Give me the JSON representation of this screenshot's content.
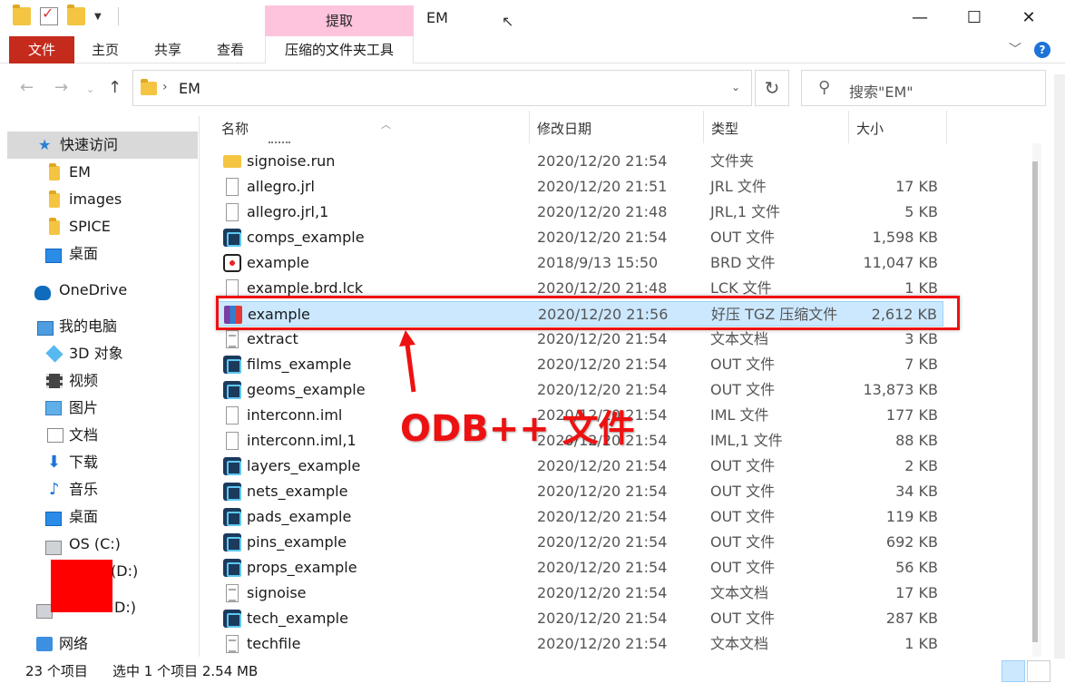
{
  "window": {
    "title": "EM",
    "context_tab_header": "提取",
    "minimize": "—",
    "maximize": "☐",
    "close": "✕"
  },
  "ribbon": {
    "file": "文件",
    "home": "主页",
    "share": "共享",
    "view": "查看",
    "context_tab": "压缩的文件夹工具"
  },
  "address": {
    "crumb": "EM",
    "search_placeholder": "搜索\"EM\""
  },
  "sidebar": {
    "quick_access": "快速访问",
    "qa_items": [
      "EM",
      "images",
      "SPICE",
      "桌面"
    ],
    "onedrive": "OneDrive",
    "this_pc": "我的电脑",
    "pc_items": [
      "3D 对象",
      "视频",
      "图片",
      "文档",
      "下载",
      "音乐",
      "桌面",
      "OS (C:)",
      "(D:)",
      "D:)"
    ],
    "network": "网络"
  },
  "columns": {
    "name": "名称",
    "modified": "修改日期",
    "type": "类型",
    "size": "大小"
  },
  "files": [
    {
      "name": "signoise.run",
      "date": "2020/12/20 21:54",
      "type": "文件夹",
      "size": "",
      "icon": "folder"
    },
    {
      "name": "allegro.jrl",
      "date": "2020/12/20 21:51",
      "type": "JRL 文件",
      "size": "17 KB",
      "icon": "file"
    },
    {
      "name": "allegro.jrl,1",
      "date": "2020/12/20 21:48",
      "type": "JRL,1 文件",
      "size": "5 KB",
      "icon": "file"
    },
    {
      "name": "comps_example",
      "date": "2020/12/20 21:54",
      "type": "OUT 文件",
      "size": "1,598 KB",
      "icon": "out"
    },
    {
      "name": "example",
      "date": "2018/9/13 15:50",
      "type": "BRD 文件",
      "size": "11,047 KB",
      "icon": "brd"
    },
    {
      "name": "example.brd.lck",
      "date": "2020/12/20 21:48",
      "type": "LCK 文件",
      "size": "1 KB",
      "icon": "file"
    },
    {
      "name": "example",
      "date": "2020/12/20 21:56",
      "type": "好压 TGZ 压缩文件",
      "size": "2,612 KB",
      "icon": "rar",
      "selected": true
    },
    {
      "name": "extract",
      "date": "2020/12/20 21:54",
      "type": "文本文档",
      "size": "3 KB",
      "icon": "txt"
    },
    {
      "name": "films_example",
      "date": "2020/12/20 21:54",
      "type": "OUT 文件",
      "size": "7 KB",
      "icon": "out"
    },
    {
      "name": "geoms_example",
      "date": "2020/12/20 21:54",
      "type": "OUT 文件",
      "size": "13,873 KB",
      "icon": "out"
    },
    {
      "name": "interconn.iml",
      "date": "2020/12/20 21:54",
      "type": "IML 文件",
      "size": "177 KB",
      "icon": "file"
    },
    {
      "name": "interconn.iml,1",
      "date": "2020/12/20 21:54",
      "type": "IML,1 文件",
      "size": "88 KB",
      "icon": "file"
    },
    {
      "name": "layers_example",
      "date": "2020/12/20 21:54",
      "type": "OUT 文件",
      "size": "2 KB",
      "icon": "out"
    },
    {
      "name": "nets_example",
      "date": "2020/12/20 21:54",
      "type": "OUT 文件",
      "size": "34 KB",
      "icon": "out"
    },
    {
      "name": "pads_example",
      "date": "2020/12/20 21:54",
      "type": "OUT 文件",
      "size": "119 KB",
      "icon": "out"
    },
    {
      "name": "pins_example",
      "date": "2020/12/20 21:54",
      "type": "OUT 文件",
      "size": "692 KB",
      "icon": "out"
    },
    {
      "name": "props_example",
      "date": "2020/12/20 21:54",
      "type": "OUT 文件",
      "size": "56 KB",
      "icon": "out"
    },
    {
      "name": "signoise",
      "date": "2020/12/20 21:54",
      "type": "文本文档",
      "size": "17 KB",
      "icon": "txt"
    },
    {
      "name": "tech_example",
      "date": "2020/12/20 21:54",
      "type": "OUT 文件",
      "size": "287 KB",
      "icon": "out"
    },
    {
      "name": "techfile",
      "date": "2020/12/20 21:54",
      "type": "文本文档",
      "size": "1 KB",
      "icon": "txt"
    }
  ],
  "annotation": {
    "text": "ODB++ 文件",
    "color": "#ee1111"
  },
  "status": {
    "count": "23 个项目",
    "selected": "选中 1 个项目  2.54 MB"
  },
  "colors": {
    "file_tab": "#c42b1c",
    "context_tab": "#ffc4dd",
    "selection": "#cce8ff"
  }
}
